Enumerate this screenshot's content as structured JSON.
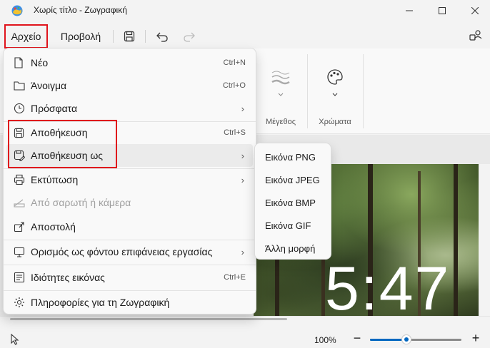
{
  "window": {
    "title": "Χωρίς τίτλο - Ζωγραφική"
  },
  "menubar": {
    "file_label": "Αρχείο",
    "view_label": "Προβολή"
  },
  "ribbon": {
    "size_label": "Μέγεθος",
    "colors_label": "Χρώματα"
  },
  "file_menu": {
    "items": [
      {
        "label": "Νέο",
        "shortcut": "Ctrl+N",
        "icon": "new-document-icon"
      },
      {
        "label": "Άνοιγμα",
        "shortcut": "Ctrl+O",
        "icon": "folder-icon"
      },
      {
        "label": "Πρόσφατα",
        "shortcut": "",
        "icon": "clock-icon",
        "submenu": true
      },
      {
        "label": "Αποθήκευση",
        "shortcut": "Ctrl+S",
        "icon": "save-icon"
      },
      {
        "label": "Αποθήκευση ως",
        "shortcut": "",
        "icon": "save-as-icon",
        "submenu": true
      },
      {
        "label": "Εκτύπωση",
        "shortcut": "",
        "icon": "printer-icon",
        "submenu": true
      },
      {
        "label": "Από σαρωτή ή κάμερα",
        "shortcut": "",
        "icon": "scanner-icon",
        "disabled": true
      },
      {
        "label": "Αποστολή",
        "shortcut": "",
        "icon": "share-icon"
      },
      {
        "label": "Ορισμός ως φόντου επιφάνειας εργασίας",
        "shortcut": "",
        "icon": "desktop-icon",
        "submenu": true
      },
      {
        "label": "Ιδιότητες εικόνας",
        "shortcut": "Ctrl+E",
        "icon": "image-properties-icon"
      },
      {
        "label": "Πληροφορίες για τη Ζωγραφική",
        "shortcut": "",
        "icon": "gear-icon"
      }
    ]
  },
  "save_as_submenu": {
    "items": [
      "Εικόνα PNG",
      "Εικόνα JPEG",
      "Εικόνα BMP",
      "Εικόνα GIF",
      "Άλλη μορφή"
    ]
  },
  "canvas": {
    "clock_text": "5:47"
  },
  "statusbar": {
    "zoom_label": "100%",
    "zoom_minus": "−",
    "zoom_plus": "+",
    "zoom_level": 0.4
  },
  "colors": {
    "highlight": "#e0141c",
    "accent": "#0067c0"
  }
}
